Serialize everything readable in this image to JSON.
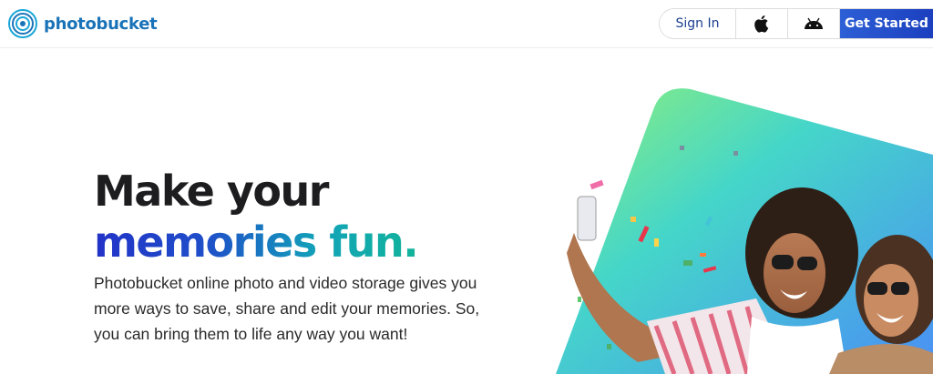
{
  "header": {
    "logo_text": "photobucket",
    "signin_label": "Sign In",
    "apple_icon": "apple-icon",
    "android_icon": "android-icon",
    "get_started_label": "Get Started"
  },
  "hero": {
    "title_line1": "Make your",
    "title_line2": "memories fun.",
    "description": "Photobucket online photo and video storage gives you more ways to save, share and edit your memories. So, you can bring them to life any way you want!"
  },
  "colors": {
    "brand_blue": "#1a73b8",
    "button_blue": "#1b3fbf",
    "gradient_start": "#2233c8",
    "gradient_end": "#12b39a"
  }
}
